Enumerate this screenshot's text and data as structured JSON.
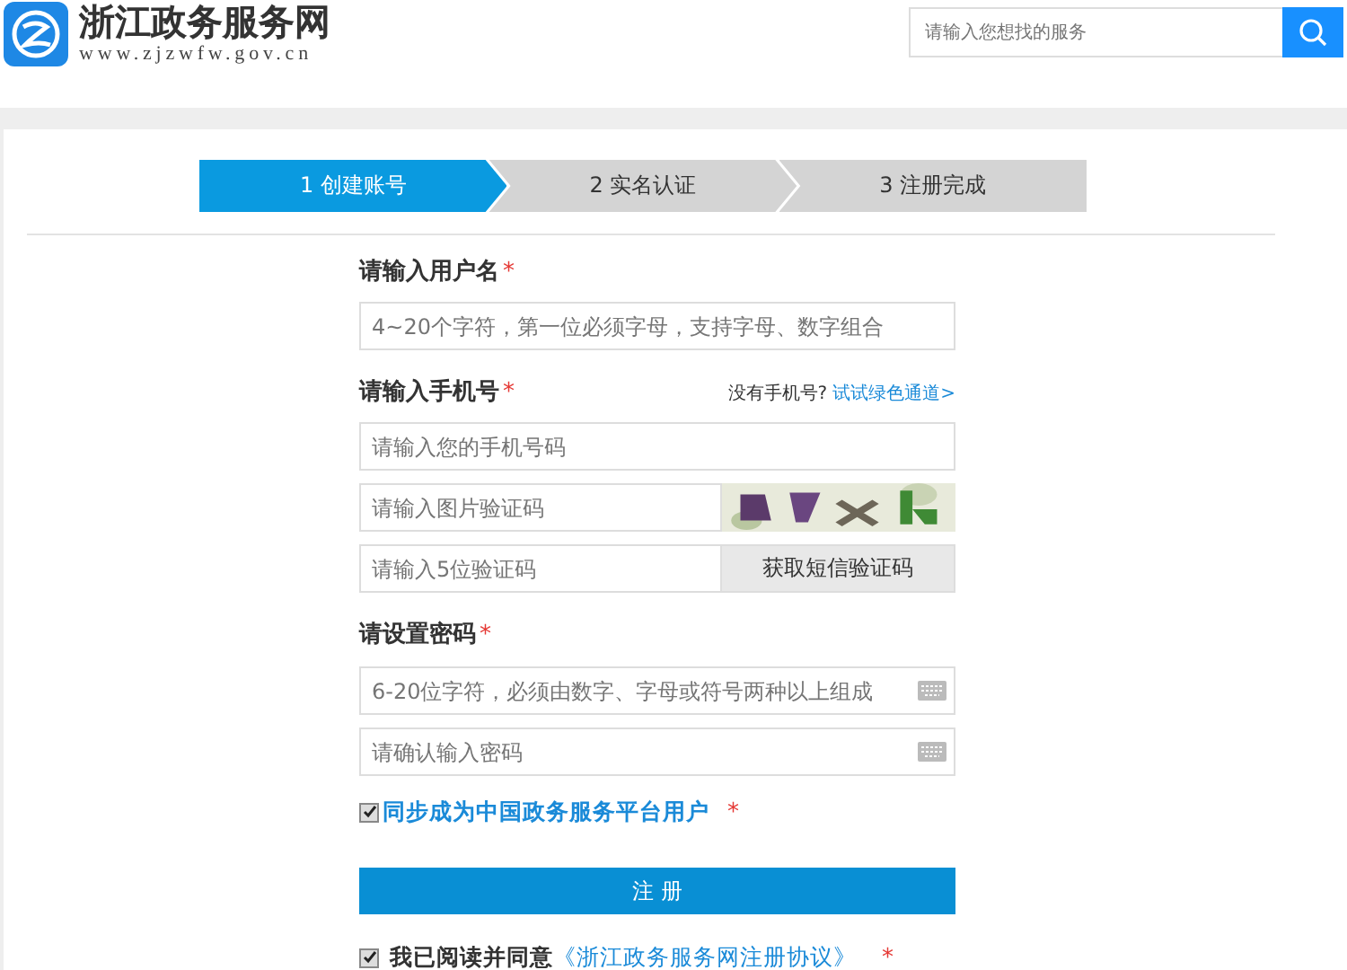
{
  "header": {
    "logo_title": "浙江政务服务网",
    "logo_url": "www.zjzwfw.gov.cn",
    "search": {
      "placeholder": "请输入您想找的服务"
    }
  },
  "steps": [
    {
      "label": "1 创建账号",
      "selected": true
    },
    {
      "label": "2 实名认证",
      "selected": false
    },
    {
      "label": "3 注册完成",
      "selected": false
    }
  ],
  "username": {
    "label": "请输入用户名",
    "mark": "*",
    "placeholder": "4~20个字符，第一位必须字母，支持字母、数字组合"
  },
  "phone": {
    "label": "请输入手机号",
    "mark": "*",
    "hint": "没有手机号?",
    "link": "试试绿色通道>",
    "placeholder": "请输入您的手机号码",
    "captcha_placeholder": "请输入图片验证码",
    "sms_placeholder": "请输入5位验证码",
    "sms_button": "获取短信验证码"
  },
  "password": {
    "label": "请设置密码",
    "mark": "*",
    "placeholder": "6-20位字符，必须由数字、字母或符号两种以上组成",
    "confirm_placeholder": "请确认输入密码"
  },
  "sync": {
    "checked": true,
    "label": "同步成为中国政务服务平台用户",
    "mark": "*"
  },
  "submit": "注 册",
  "agree": {
    "checked": true,
    "text": "我已阅读并同意",
    "link": "《浙江政务服务网注册协议》",
    "mark": "*"
  }
}
